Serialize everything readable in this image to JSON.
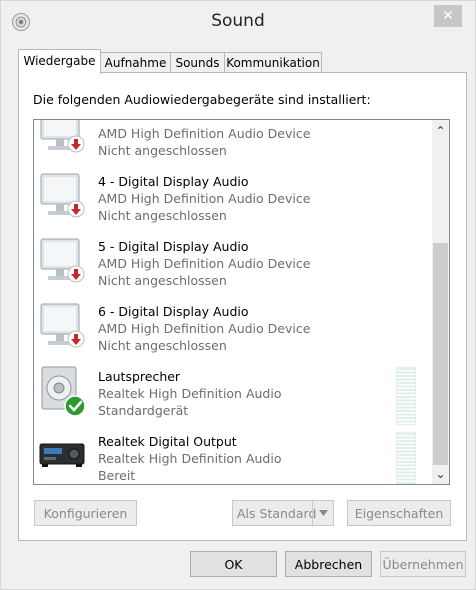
{
  "window": {
    "title": "Sound",
    "icon": "speaker-icon",
    "close_icon": "close-icon"
  },
  "tabs": [
    {
      "label": "Wiedergabe",
      "active": true
    },
    {
      "label": "Aufnahme",
      "active": false
    },
    {
      "label": "Sounds",
      "active": false
    },
    {
      "label": "Kommunikation",
      "active": false
    }
  ],
  "panel": {
    "instruction": "Die folgenden Audiowiedergabegeräte sind installiert:"
  },
  "devices": [
    {
      "name": "",
      "driver": "AMD High Definition Audio Device",
      "status": "Nicht angeschlossen",
      "icon": "monitor-icon",
      "badge": "disconnected-badge-icon"
    },
    {
      "name": "4 - Digital Display Audio",
      "driver": "AMD High Definition Audio Device",
      "status": "Nicht angeschlossen",
      "icon": "monitor-icon",
      "badge": "disconnected-badge-icon"
    },
    {
      "name": "5 - Digital Display Audio",
      "driver": "AMD High Definition Audio Device",
      "status": "Nicht angeschlossen",
      "icon": "monitor-icon",
      "badge": "disconnected-badge-icon"
    },
    {
      "name": "6 - Digital Display Audio",
      "driver": "AMD High Definition Audio Device",
      "status": "Nicht angeschlossen",
      "icon": "monitor-icon",
      "badge": "disconnected-badge-icon"
    },
    {
      "name": "Lautsprecher",
      "driver": "Realtek High Definition Audio",
      "status": "Standardgerät",
      "icon": "speaker-device-icon",
      "badge": "default-check-icon"
    },
    {
      "name": "Realtek Digital Output",
      "driver": "Realtek High Definition Audio",
      "status": "Bereit",
      "icon": "digital-receiver-icon",
      "badge": ""
    }
  ],
  "buttons": {
    "configure": "Konfigurieren",
    "set_default": "Als Standard",
    "properties": "Eigenschaften",
    "ok": "OK",
    "cancel": "Abbrechen",
    "apply": "Übernehmen"
  },
  "colors": {
    "disconnected_badge": "#c62828",
    "default_check": "#2e9a2e",
    "level_meter": "#dff0ec"
  }
}
